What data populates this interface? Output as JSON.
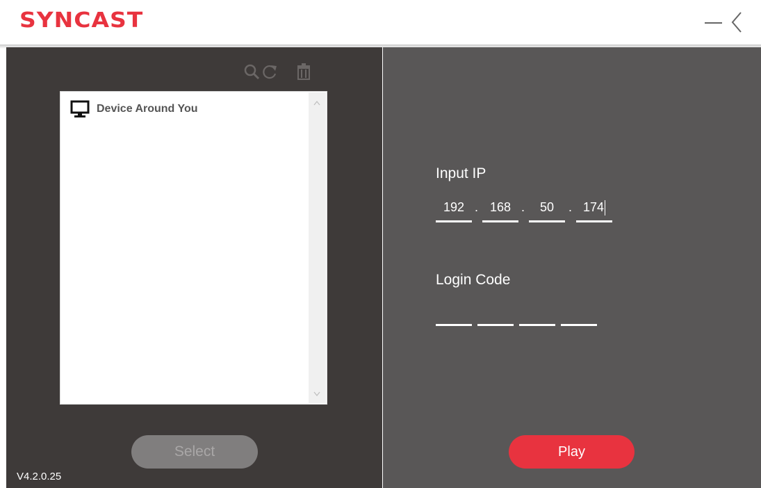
{
  "app": {
    "logo_text": "SYNCAST",
    "version": "V4.2.0.25"
  },
  "window_controls": {
    "minimize_icon": "minimize-icon",
    "back_icon": "chevron-left-icon"
  },
  "toolbar": {
    "icons": [
      "search-icon",
      "refresh-icon",
      "trash-icon"
    ]
  },
  "device_list": {
    "header": "Device Around You",
    "header_icon": "monitor-icon",
    "items": []
  },
  "buttons": {
    "select_label": "Select",
    "play_label": "Play"
  },
  "ip_input": {
    "label": "Input IP",
    "octets": [
      "192",
      "168",
      "50",
      "174"
    ],
    "separator": "."
  },
  "login_code": {
    "label": "Login Code",
    "segments": [
      "",
      "",
      "",
      ""
    ]
  },
  "colors": {
    "accent": "#e8333f",
    "left_panel": "#3e3a39",
    "right_panel": "#595757"
  }
}
